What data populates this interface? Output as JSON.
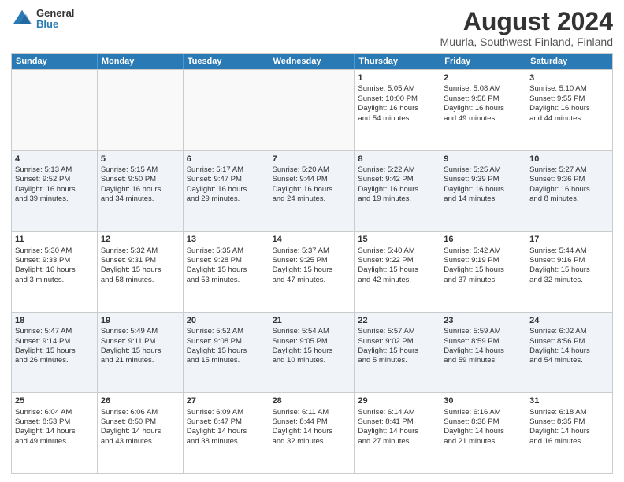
{
  "header": {
    "logo_line1": "General",
    "logo_line2": "Blue",
    "title": "August 2024",
    "subtitle": "Muurla, Southwest Finland, Finland"
  },
  "weekdays": [
    "Sunday",
    "Monday",
    "Tuesday",
    "Wednesday",
    "Thursday",
    "Friday",
    "Saturday"
  ],
  "rows": [
    [
      {
        "day": "",
        "info": ""
      },
      {
        "day": "",
        "info": ""
      },
      {
        "day": "",
        "info": ""
      },
      {
        "day": "",
        "info": ""
      },
      {
        "day": "1",
        "info": "Sunrise: 5:05 AM\nSunset: 10:00 PM\nDaylight: 16 hours\nand 54 minutes."
      },
      {
        "day": "2",
        "info": "Sunrise: 5:08 AM\nSunset: 9:58 PM\nDaylight: 16 hours\nand 49 minutes."
      },
      {
        "day": "3",
        "info": "Sunrise: 5:10 AM\nSunset: 9:55 PM\nDaylight: 16 hours\nand 44 minutes."
      }
    ],
    [
      {
        "day": "4",
        "info": "Sunrise: 5:13 AM\nSunset: 9:52 PM\nDaylight: 16 hours\nand 39 minutes."
      },
      {
        "day": "5",
        "info": "Sunrise: 5:15 AM\nSunset: 9:50 PM\nDaylight: 16 hours\nand 34 minutes."
      },
      {
        "day": "6",
        "info": "Sunrise: 5:17 AM\nSunset: 9:47 PM\nDaylight: 16 hours\nand 29 minutes."
      },
      {
        "day": "7",
        "info": "Sunrise: 5:20 AM\nSunset: 9:44 PM\nDaylight: 16 hours\nand 24 minutes."
      },
      {
        "day": "8",
        "info": "Sunrise: 5:22 AM\nSunset: 9:42 PM\nDaylight: 16 hours\nand 19 minutes."
      },
      {
        "day": "9",
        "info": "Sunrise: 5:25 AM\nSunset: 9:39 PM\nDaylight: 16 hours\nand 14 minutes."
      },
      {
        "day": "10",
        "info": "Sunrise: 5:27 AM\nSunset: 9:36 PM\nDaylight: 16 hours\nand 8 minutes."
      }
    ],
    [
      {
        "day": "11",
        "info": "Sunrise: 5:30 AM\nSunset: 9:33 PM\nDaylight: 16 hours\nand 3 minutes."
      },
      {
        "day": "12",
        "info": "Sunrise: 5:32 AM\nSunset: 9:31 PM\nDaylight: 15 hours\nand 58 minutes."
      },
      {
        "day": "13",
        "info": "Sunrise: 5:35 AM\nSunset: 9:28 PM\nDaylight: 15 hours\nand 53 minutes."
      },
      {
        "day": "14",
        "info": "Sunrise: 5:37 AM\nSunset: 9:25 PM\nDaylight: 15 hours\nand 47 minutes."
      },
      {
        "day": "15",
        "info": "Sunrise: 5:40 AM\nSunset: 9:22 PM\nDaylight: 15 hours\nand 42 minutes."
      },
      {
        "day": "16",
        "info": "Sunrise: 5:42 AM\nSunset: 9:19 PM\nDaylight: 15 hours\nand 37 minutes."
      },
      {
        "day": "17",
        "info": "Sunrise: 5:44 AM\nSunset: 9:16 PM\nDaylight: 15 hours\nand 32 minutes."
      }
    ],
    [
      {
        "day": "18",
        "info": "Sunrise: 5:47 AM\nSunset: 9:14 PM\nDaylight: 15 hours\nand 26 minutes."
      },
      {
        "day": "19",
        "info": "Sunrise: 5:49 AM\nSunset: 9:11 PM\nDaylight: 15 hours\nand 21 minutes."
      },
      {
        "day": "20",
        "info": "Sunrise: 5:52 AM\nSunset: 9:08 PM\nDaylight: 15 hours\nand 15 minutes."
      },
      {
        "day": "21",
        "info": "Sunrise: 5:54 AM\nSunset: 9:05 PM\nDaylight: 15 hours\nand 10 minutes."
      },
      {
        "day": "22",
        "info": "Sunrise: 5:57 AM\nSunset: 9:02 PM\nDaylight: 15 hours\nand 5 minutes."
      },
      {
        "day": "23",
        "info": "Sunrise: 5:59 AM\nSunset: 8:59 PM\nDaylight: 14 hours\nand 59 minutes."
      },
      {
        "day": "24",
        "info": "Sunrise: 6:02 AM\nSunset: 8:56 PM\nDaylight: 14 hours\nand 54 minutes."
      }
    ],
    [
      {
        "day": "25",
        "info": "Sunrise: 6:04 AM\nSunset: 8:53 PM\nDaylight: 14 hours\nand 49 minutes."
      },
      {
        "day": "26",
        "info": "Sunrise: 6:06 AM\nSunset: 8:50 PM\nDaylight: 14 hours\nand 43 minutes."
      },
      {
        "day": "27",
        "info": "Sunrise: 6:09 AM\nSunset: 8:47 PM\nDaylight: 14 hours\nand 38 minutes."
      },
      {
        "day": "28",
        "info": "Sunrise: 6:11 AM\nSunset: 8:44 PM\nDaylight: 14 hours\nand 32 minutes."
      },
      {
        "day": "29",
        "info": "Sunrise: 6:14 AM\nSunset: 8:41 PM\nDaylight: 14 hours\nand 27 minutes."
      },
      {
        "day": "30",
        "info": "Sunrise: 6:16 AM\nSunset: 8:38 PM\nDaylight: 14 hours\nand 21 minutes."
      },
      {
        "day": "31",
        "info": "Sunrise: 6:18 AM\nSunset: 8:35 PM\nDaylight: 14 hours\nand 16 minutes."
      }
    ]
  ]
}
